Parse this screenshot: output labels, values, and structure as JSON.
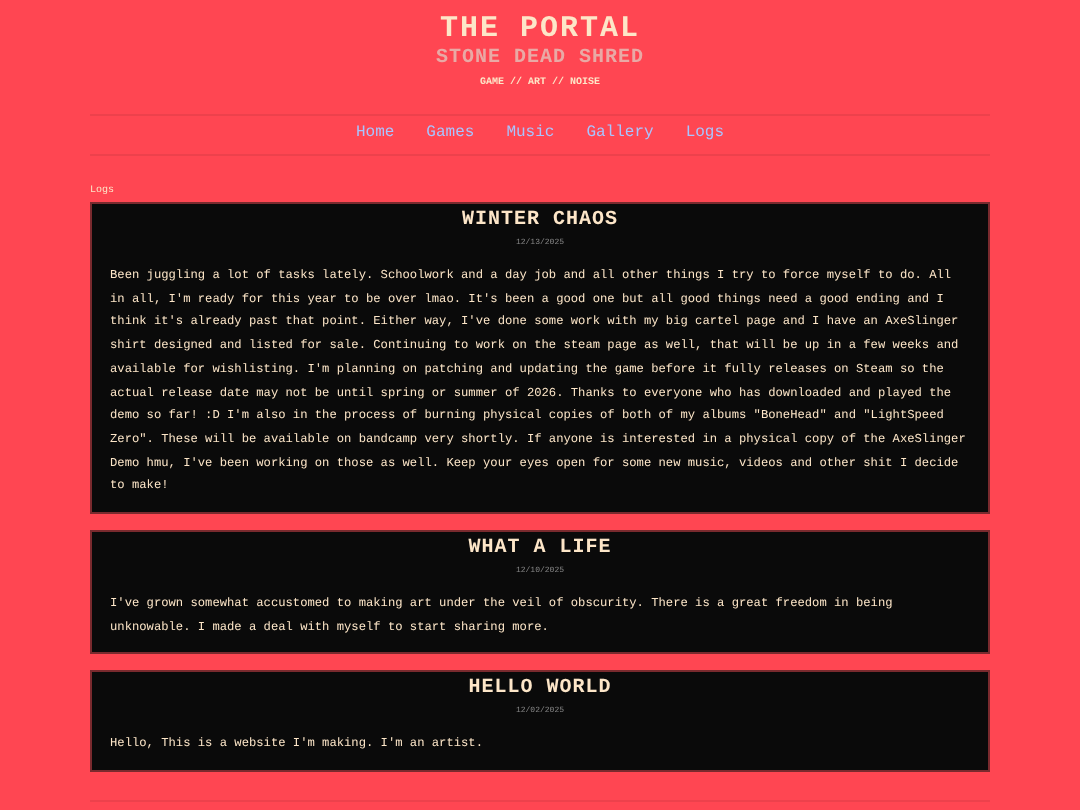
{
  "header": {
    "title": "THE PORTAL",
    "subtitle": "STONE DEAD SHRED",
    "tagline": "GAME // ART // NOISE"
  },
  "nav": [
    {
      "label": "Home"
    },
    {
      "label": "Games"
    },
    {
      "label": "Music"
    },
    {
      "label": "Gallery"
    },
    {
      "label": "Logs"
    }
  ],
  "section_label": "Logs",
  "posts": [
    {
      "title": "WINTER CHAOS",
      "date": "12/13/2025",
      "body": "Been juggling a lot of tasks lately. Schoolwork and a day job and all other things I try to force myself to do. All in all, I'm ready for this year to be over lmao. It's been a good one but all good things need a good ending and I think it's already past that point. Either way, I've done some work with my big cartel page and I have an AxeSlinger shirt designed and listed for sale. Continuing to work on the steam page as well, that will be up in a few weeks and available for wishlisting. I'm planning on patching and updating the game before it fully releases on Steam so the actual release date may not be until spring or summer of 2026. Thanks to everyone who has downloaded and played the demo so far! :D I'm also in the process of burning physical copies of both of my albums \"BoneHead\" and \"LightSpeed Zero\". These will be available on bandcamp very shortly. If anyone is interested in a physical copy of the AxeSlinger Demo hmu, I've been working on those as well. Keep your eyes open for some new music, videos and other shit I decide to make!"
    },
    {
      "title": "WHAT A LIFE",
      "date": "12/10/2025",
      "body": "I've grown somewhat accustomed to making art under the veil of obscurity. There is a great freedom in being unknowable. I made a deal with myself to start sharing more."
    },
    {
      "title": "HELLO WORLD",
      "date": "12/02/2025",
      "body": "Hello, This is a website I'm making. I'm an artist."
    }
  ]
}
